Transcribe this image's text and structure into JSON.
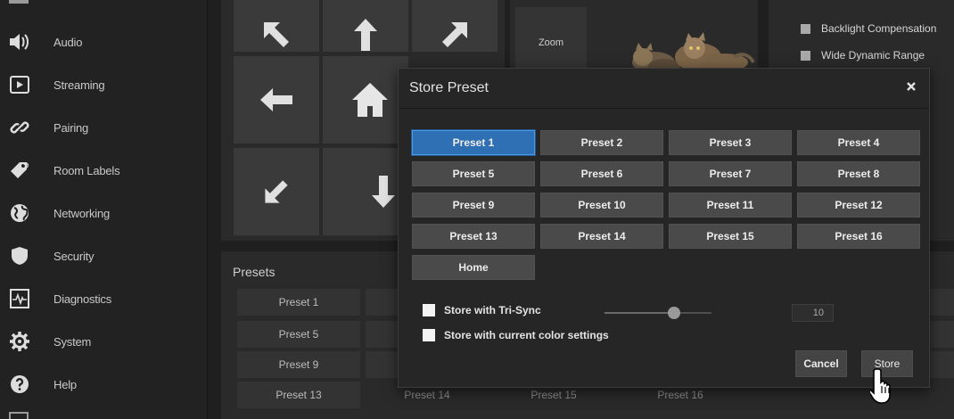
{
  "sidebar": {
    "items": [
      {
        "label": "Audio",
        "icon": "speaker-icon"
      },
      {
        "label": "Streaming",
        "icon": "play-icon"
      },
      {
        "label": "Pairing",
        "icon": "link-icon"
      },
      {
        "label": "Room Labels",
        "icon": "tag-icon"
      },
      {
        "label": "Networking",
        "icon": "globe-icon"
      },
      {
        "label": "Security",
        "icon": "shield-icon"
      },
      {
        "label": "Diagnostics",
        "icon": "pulse-icon"
      },
      {
        "label": "System",
        "icon": "gear-icon"
      },
      {
        "label": "Help",
        "icon": "help-icon"
      }
    ]
  },
  "camera": {
    "zoom_label": "Zoom",
    "backlight_label": "Backlight Compensation",
    "wdr_label": "Wide Dynamic Range"
  },
  "presets_panel": {
    "title": "Presets",
    "rows": [
      [
        "Preset 1"
      ],
      [
        "Preset 5"
      ],
      [
        "Preset 9"
      ],
      [
        "Preset 13",
        "Preset 14",
        "Preset 15",
        "Preset 16"
      ]
    ]
  },
  "modal": {
    "title": "Store Preset",
    "close_icon": "close-icon",
    "presets": [
      "Preset 1",
      "Preset 2",
      "Preset 3",
      "Preset 4",
      "Preset 5",
      "Preset 6",
      "Preset 7",
      "Preset 8",
      "Preset 9",
      "Preset 10",
      "Preset 11",
      "Preset 12",
      "Preset 13",
      "Preset 14",
      "Preset 15",
      "Preset 16",
      "Home"
    ],
    "selected_preset": "Preset 1",
    "tri_sync_label": "Store with Tri-Sync",
    "color_label": "Store with current color settings",
    "tri_sync_value": "10",
    "tri_sync_slider_fraction": 0.65,
    "cancel_label": "Cancel",
    "store_label": "Store"
  },
  "colors": {
    "selected_blue": "#2f6fb3",
    "button_gray": "#4a4a4a",
    "modal_bg": "#262626"
  }
}
